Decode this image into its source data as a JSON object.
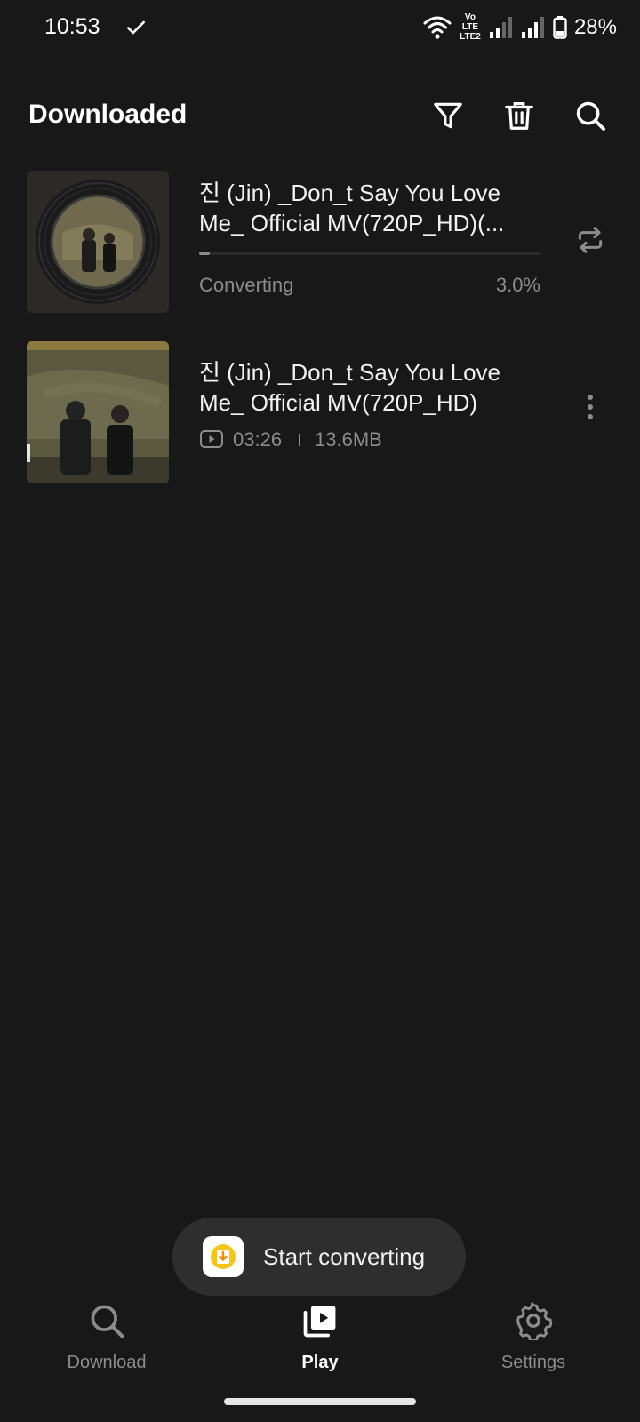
{
  "status_bar": {
    "time": "10:53",
    "volte_top": "Vo LTE",
    "volte_bottom": "LTE2",
    "battery": "28%"
  },
  "header": {
    "title": "Downloaded",
    "icons": [
      "filter-icon",
      "trash-icon",
      "search-icon"
    ]
  },
  "items": [
    {
      "title_line1": "진 (Jin) _Don_t Say You Love",
      "title_line2": "Me_ Official MV(720P_HD)(...",
      "status": "Converting",
      "progress_label": "3.0%",
      "progress": 0.03,
      "action_icon": "convert-repeat-icon"
    },
    {
      "title_line1": "진 (Jin) _Don_t Say You Love",
      "title_line2": "Me_ Official MV(720P_HD)",
      "duration": "03:26",
      "size": "13.6MB",
      "action_icon": "more-vertical-icon"
    }
  ],
  "toast": {
    "text": "Start converting"
  },
  "nav": {
    "items": [
      {
        "label": "Download",
        "icon": "search-icon",
        "active": false
      },
      {
        "label": "Play",
        "icon": "play-library-icon",
        "active": true
      },
      {
        "label": "Settings",
        "icon": "gear-icon",
        "active": false
      }
    ]
  },
  "colors": {
    "background": "#181818",
    "text_primary": "#f2f2f2",
    "text_secondary": "#8c8c8c",
    "toast_bg": "#2e2e2e",
    "accent_yellow": "#f5c518"
  }
}
